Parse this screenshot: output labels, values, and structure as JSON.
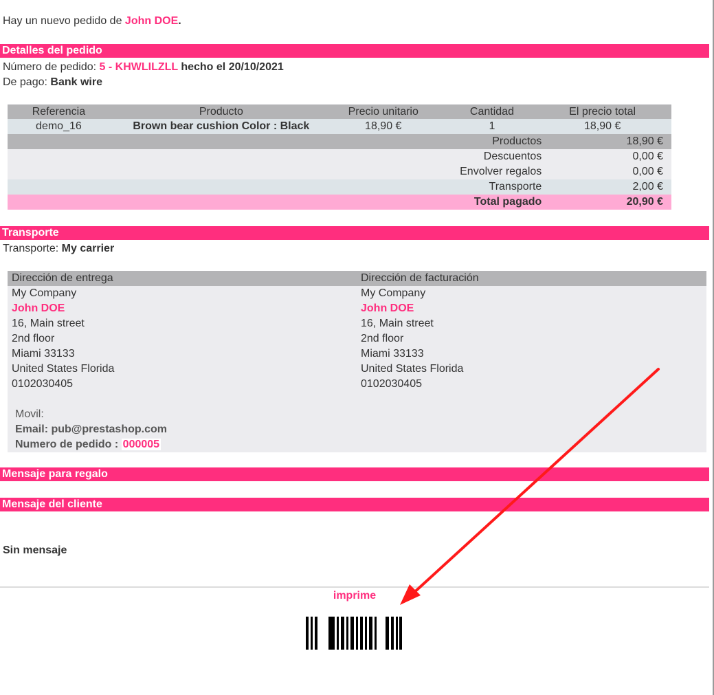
{
  "intro": {
    "prefix": "Hay un nuevo pedido de ",
    "customer": "John DOE",
    "suffix": "."
  },
  "order_details": {
    "title": "Detalles del pedido",
    "order_number_label": "Número de pedido: ",
    "order_ref": "5 - KHWLILZLL",
    "made_on": " hecho el 20/10/2021",
    "payment_label": "De pago: ",
    "payment_method": "Bank wire"
  },
  "products_table": {
    "headers": [
      "Referencia",
      "Producto",
      "Precio unitario",
      "Cantidad",
      "El precio total"
    ],
    "rows": [
      {
        "reference": "demo_16",
        "product": "Brown bear cushion Color : Black",
        "unit_price": "18,90 €",
        "quantity": "1",
        "total": "18,90 €"
      }
    ],
    "totals": [
      {
        "label": "Productos",
        "value": "18,90 €"
      },
      {
        "label": "Descuentos",
        "value": "0,00 €"
      },
      {
        "label": "Envolver regalos",
        "value": "0,00 €"
      },
      {
        "label": "Transporte",
        "value": "2,00 €"
      }
    ],
    "grand_total_label": "Total pagado",
    "grand_total_value": "20,90 €"
  },
  "shipping": {
    "title": "Transporte",
    "carrier_label": "Transporte: ",
    "carrier": "My carrier"
  },
  "addresses": {
    "delivery": {
      "title": "Dirección de entrega",
      "company": "My Company",
      "name": "John DOE",
      "street": "16, Main street",
      "street2": "2nd floor",
      "city": "Miami 33133",
      "country": "United States Florida",
      "phone": "0102030405"
    },
    "invoice": {
      "title": "Dirección de facturación",
      "company": "My Company",
      "name": "John DOE",
      "street": "16, Main street",
      "street2": "2nd floor",
      "city": "Miami 33133",
      "country": "United States Florida",
      "phone": "0102030405"
    },
    "mobile_label": "Movil:",
    "email_label": "Email: ",
    "email": "pub@prestashop.com",
    "order_number_label": "Numero de pedido : ",
    "order_number": "000005"
  },
  "gift_message": {
    "title": "Mensaje para regalo"
  },
  "customer_message": {
    "title": "Mensaje del cliente",
    "body": "Sin mensaje"
  },
  "footer": {
    "print_label": "imprime"
  },
  "colors": {
    "accent": "#ff2e7e",
    "table_header": "#b4b4b6",
    "total_row": "#ffaad4",
    "annotation_arrow": "#ff1a1a"
  }
}
